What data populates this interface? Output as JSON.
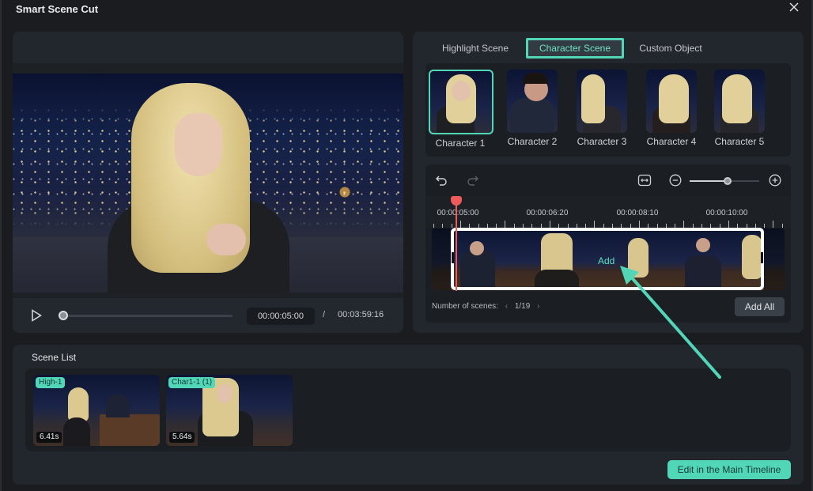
{
  "window": {
    "title": "Smart Scene Cut",
    "close_icon": "close-icon"
  },
  "preview": {
    "current_time": "00:00:05:00",
    "separator": "/",
    "total_time": "00:03:59:16",
    "progress_fraction": 0.02,
    "play_icon": "play-icon"
  },
  "tabs": [
    {
      "label": "Highlight Scene",
      "active": false
    },
    {
      "label": "Character Scene",
      "active": true
    },
    {
      "label": "Custom Object",
      "active": false
    }
  ],
  "characters": [
    {
      "label": "Character 1",
      "selected": true
    },
    {
      "label": "Character 2",
      "selected": false
    },
    {
      "label": "Character 3",
      "selected": false
    },
    {
      "label": "Character 4",
      "selected": false
    },
    {
      "label": "Character 5",
      "selected": false
    }
  ],
  "timeline": {
    "undo_icon": "undo-icon",
    "redo_icon": "redo-icon",
    "fit_icon": "fit-to-width-icon",
    "zoom_out_icon": "zoom-out-icon",
    "zoom_in_icon": "zoom-in-icon",
    "zoom_level_fraction": 0.55,
    "ruler_labels": [
      "00:00:05:00",
      "00:00:06:20",
      "00:00:08:10",
      "00:00:10:00"
    ],
    "add_label": "Add",
    "scene_count_label": "Number of scenes:",
    "scene_prev": "‹",
    "scene_index": "1/19",
    "scene_next": "›",
    "add_all_label": "Add All"
  },
  "scene_list": {
    "title": "Scene List",
    "items": [
      {
        "tag": "High-1",
        "duration": "6.41s"
      },
      {
        "tag": "Char1-1 (1)",
        "duration": "5.64s"
      }
    ]
  },
  "footer": {
    "edit_button_label": "Edit in the Main Timeline"
  },
  "colors": {
    "accent": "#52d6b8",
    "playhead": "#ef5a5a",
    "background": "#1a1c1f",
    "panel": "#22272d"
  }
}
